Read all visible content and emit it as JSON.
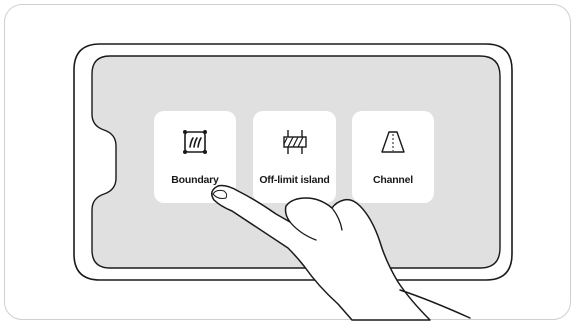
{
  "screen": {
    "tiles": [
      {
        "label": "Boundary",
        "icon": "boundary-icon"
      },
      {
        "label": "Off-limit island",
        "icon": "off-limit-island-icon"
      },
      {
        "label": "Channel",
        "icon": "channel-icon"
      }
    ]
  },
  "illustration": {
    "hand": "pointing-hand",
    "target_tile": "Boundary"
  },
  "colors": {
    "screen_background": "#e0e0e0",
    "tile_background": "#ffffff",
    "outline": "#1a1a1a",
    "frame_border": "#cfcfcf"
  }
}
